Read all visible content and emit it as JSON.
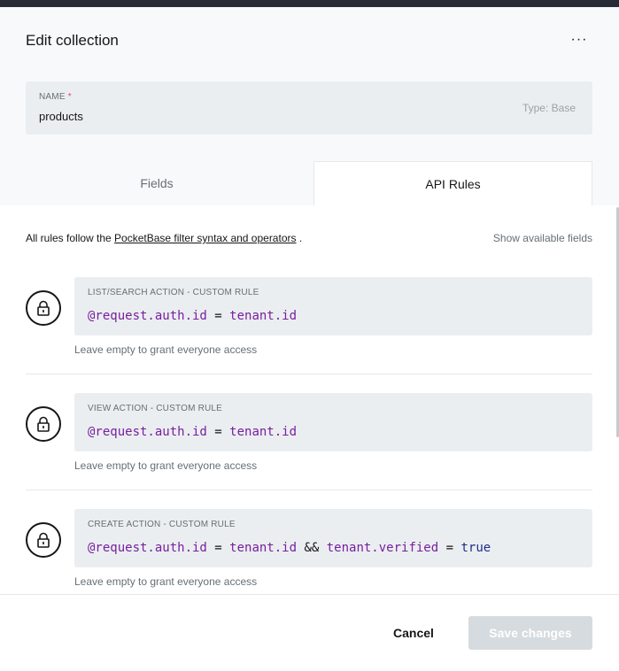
{
  "header": {
    "title": "Edit collection",
    "more_label": "···"
  },
  "name_field": {
    "label": "Name",
    "required_mark": "*",
    "value": "products",
    "type_hint": "Type: Base"
  },
  "tabs": [
    {
      "label": "Fields",
      "active": false
    },
    {
      "label": "API Rules",
      "active": true
    }
  ],
  "info": {
    "prefix": "All rules follow the ",
    "link": "PocketBase filter syntax and operators",
    "suffix": " .",
    "show_fields": "Show available fields"
  },
  "rules": [
    {
      "label": "List/Search action - custom rule",
      "tokens": [
        {
          "text": "@request.auth.id",
          "kind": "prop"
        },
        {
          "text": " = ",
          "kind": "op"
        },
        {
          "text": "tenant.id",
          "kind": "prop"
        }
      ],
      "help": "Leave empty to grant everyone access"
    },
    {
      "label": "View action - custom rule",
      "tokens": [
        {
          "text": "@request.auth.id",
          "kind": "prop"
        },
        {
          "text": " = ",
          "kind": "op"
        },
        {
          "text": "tenant.id",
          "kind": "prop"
        }
      ],
      "help": "Leave empty to grant everyone access"
    },
    {
      "label": "Create action - custom rule",
      "tokens": [
        {
          "text": "@request.auth.id",
          "kind": "prop"
        },
        {
          "text": " = ",
          "kind": "op"
        },
        {
          "text": "tenant.id",
          "kind": "prop"
        },
        {
          "text": " && ",
          "kind": "op"
        },
        {
          "text": "tenant.verified",
          "kind": "prop"
        },
        {
          "text": " = ",
          "kind": "op"
        },
        {
          "text": "true",
          "kind": "kw"
        }
      ],
      "help": "Leave empty to grant everyone access"
    }
  ],
  "footer": {
    "cancel": "Cancel",
    "save": "Save changes"
  },
  "colors": {
    "accent_text": "#16161a",
    "muted": "#666f75",
    "field_bg": "#ebeef0",
    "prop_token": "#771fa0",
    "keyword_token": "#1f2c8c",
    "save_disabled_bg": "#d6dbdf"
  }
}
